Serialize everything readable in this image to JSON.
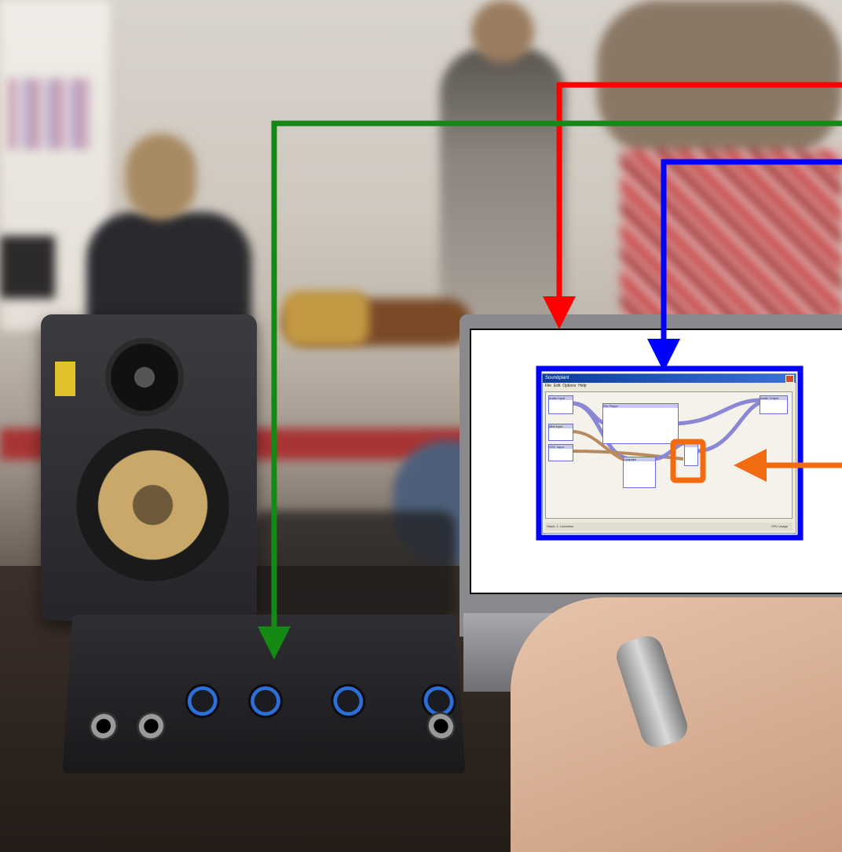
{
  "photo": {
    "subject": "audio-interface-setup"
  },
  "app_window": {
    "title": "Soundplant",
    "menu": [
      "File",
      "Edit",
      "Options",
      "Help"
    ],
    "nodes": [
      {
        "id": "audio-input",
        "label": "Audio Input"
      },
      {
        "id": "midi-input",
        "label": "Midi Input"
      },
      {
        "id": "osc-input",
        "label": "OSC Input"
      },
      {
        "id": "file-player",
        "label": "File Player"
      },
      {
        "id": "lowpass",
        "label": "Lowpass"
      },
      {
        "id": "audio-output",
        "label": "Audio Output"
      }
    ],
    "status_left": "Stack: 1. Loudness",
    "status_right": "CPU Usage"
  },
  "annotation_colors": {
    "red": "#ff0000",
    "green": "#148a14",
    "blue": "#0000ff",
    "orange": "#f26b0f"
  }
}
